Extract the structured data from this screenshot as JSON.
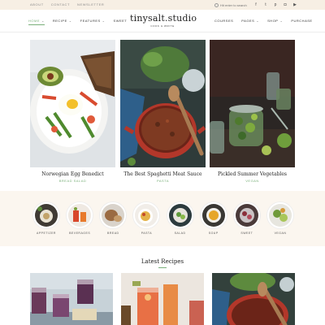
{
  "topbar": {
    "links": [
      "ABOUT",
      "CONTACT",
      "NEWSLETTER"
    ],
    "search_placeholder": "Hit enter to search",
    "social_icons": [
      "facebook-icon",
      "twitter-icon",
      "pinterest-icon",
      "instagram-icon",
      "youtube-icon"
    ]
  },
  "nav": {
    "left": [
      {
        "label": "HOME",
        "active": true,
        "dropdown": true
      },
      {
        "label": "RECIPE",
        "active": false,
        "dropdown": true
      },
      {
        "label": "FEATURES",
        "active": false,
        "dropdown": true
      },
      {
        "label": "SWEET",
        "active": false,
        "dropdown": false
      }
    ],
    "right": [
      {
        "label": "COURSES",
        "dropdown": false
      },
      {
        "label": "PAGES",
        "dropdown": true
      },
      {
        "label": "SHOP",
        "dropdown": true
      },
      {
        "label": "PURCHASE",
        "dropdown": false
      }
    ],
    "chevron": "⌄"
  },
  "logo": {
    "name": "tinysalt.studio",
    "tagline": "COOK & WRITE"
  },
  "featured": [
    {
      "title": "Norwegian Egg Benedict",
      "category": "BREAD SALAD"
    },
    {
      "title": "The Best Spaghetti Meat Sauce",
      "category": "PASTA"
    },
    {
      "title": "Pickled Summer Vegetables",
      "category": "VEGAN"
    }
  ],
  "categories": [
    "APPETIZER",
    "BEVERAGES",
    "BREAD",
    "PASTA",
    "SALAD",
    "SOUP",
    "SWEET",
    "VEGAN"
  ],
  "latest": {
    "heading": "Latest Recipes"
  },
  "colors": {
    "accent": "#7ab07a",
    "topbar_bg": "#f7efe4",
    "band_bg": "#fbf6ef"
  }
}
